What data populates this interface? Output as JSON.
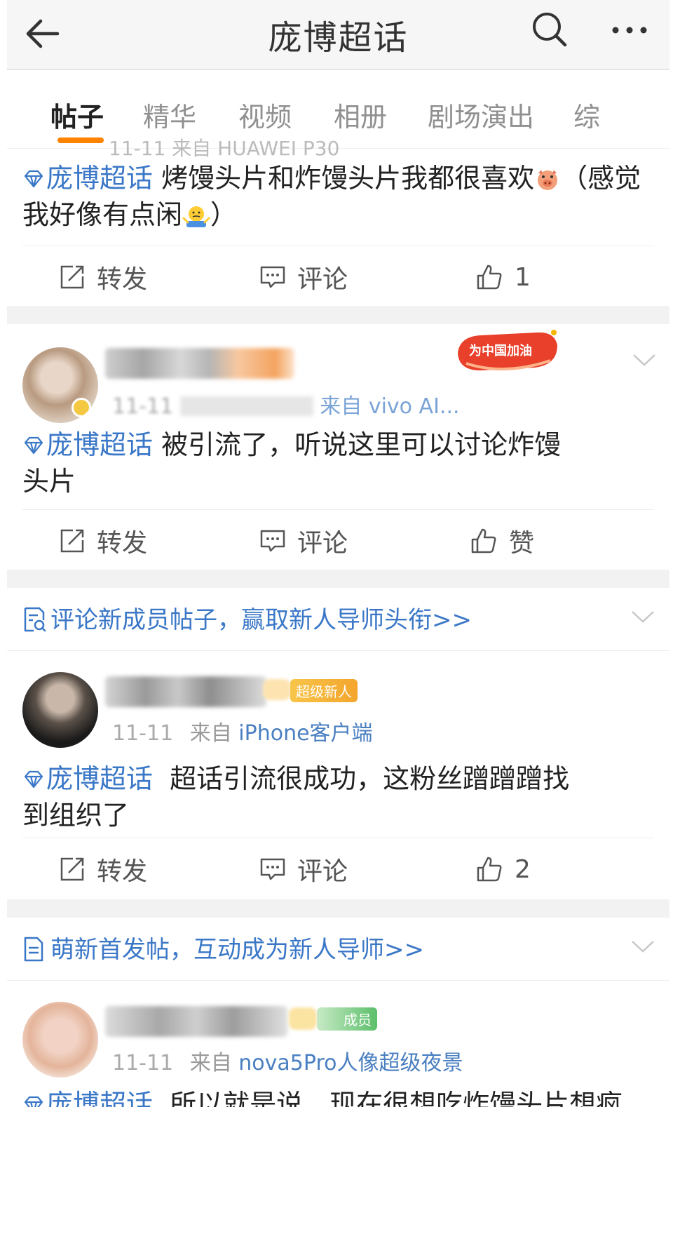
{
  "header": {
    "title": "庞博超话"
  },
  "tabs": [
    {
      "label": "帖子",
      "active": true
    },
    {
      "label": "精华",
      "active": false
    },
    {
      "label": "视频",
      "active": false
    },
    {
      "label": "相册",
      "active": false
    },
    {
      "label": "剧场演出",
      "active": false
    },
    {
      "label": "综",
      "active": false
    }
  ],
  "colors": {
    "accent": "#ff8200",
    "link": "#3a77c7",
    "text": "#222222",
    "muted": "#999999"
  },
  "posts": [
    {
      "meta_partial": "11-11  来自 HUAWEI P30",
      "topic": "庞博超话",
      "text": "烤馒头片和炸馒头片我都很喜欢",
      "text_tail": "（感觉我好像有点闲",
      "text_end": "）",
      "emoji_1": "pig-emoji",
      "emoji_2": "shrug-emoji",
      "actions": {
        "repost": "转发",
        "comment": "评论",
        "like": "1"
      }
    },
    {
      "meta_date": "11-11",
      "meta_src": "来自 vivo AI...",
      "topic": "庞博超话",
      "text": "被引流了，听说这里可以讨论炸馒头片",
      "sticker_text": "为中国加油",
      "actions": {
        "repost": "转发",
        "comment": "评论",
        "like": "赞"
      }
    },
    {
      "meta_date": "11-11",
      "meta_from": "来自",
      "meta_src": "iPhone客户端",
      "badge": "超级新人",
      "topic": "庞博超话",
      "text": "超话引流很成功，这粉丝蹭蹭蹭找到组织了",
      "actions": {
        "repost": "转发",
        "comment": "评论",
        "like": "2"
      }
    },
    {
      "meta_date": "11-11",
      "meta_from": "来自",
      "meta_src": "nova5Pro人像超级夜景",
      "badge": "成员",
      "topic": "庞博超话",
      "text_partial": "所以就是说，现在很想吃炸馒头片想疯"
    }
  ],
  "banners": [
    {
      "text": "评论新成员帖子，赢取新人导师头衔>>",
      "icon": "document-search-icon"
    },
    {
      "text": "萌新首发帖，互动成为新人导师>>",
      "icon": "document-icon"
    }
  ]
}
